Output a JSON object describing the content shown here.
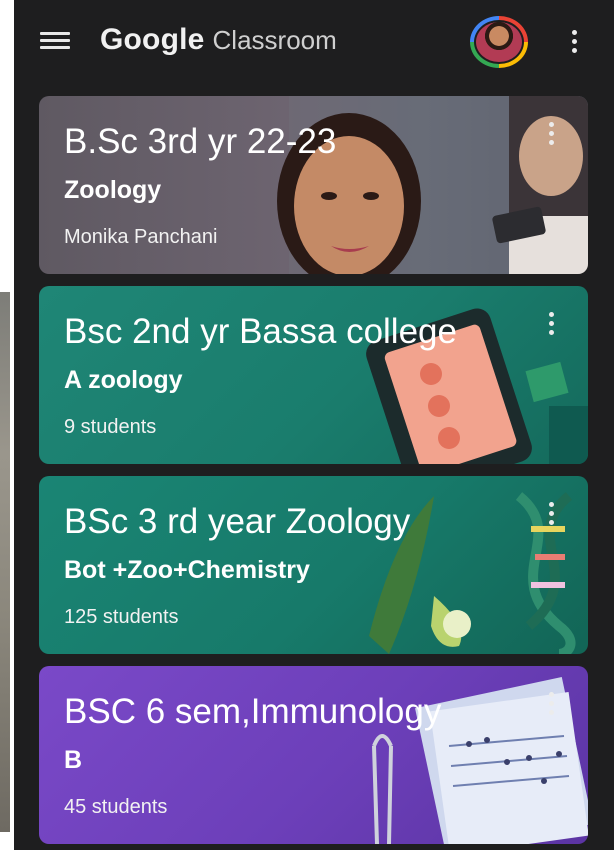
{
  "app": {
    "brand_primary": "Google",
    "brand_secondary": "Classroom"
  },
  "icons": {
    "menu": "hamburger-menu-icon",
    "overflow": "vertical-ellipsis-icon",
    "avatar": "user-avatar"
  },
  "classes": [
    {
      "title": "B.Sc 3rd yr 22-23",
      "subtitle": "Zoology",
      "meta": "Monika Panchani",
      "theme_color": "#6b6470"
    },
    {
      "title": "Bsc 2nd yr Bassa college",
      "subtitle": "A zoology",
      "meta": "9 students",
      "theme_color": "#1a7d6d"
    },
    {
      "title": "BSc 3 rd year Zoology",
      "subtitle": "Bot +Zoo+Chemistry",
      "meta": "125 students",
      "theme_color": "#177a6a"
    },
    {
      "title": "BSC 6 sem,Immunology",
      "subtitle": "B",
      "meta": "45 students",
      "theme_color": "#6c3fb9"
    }
  ]
}
